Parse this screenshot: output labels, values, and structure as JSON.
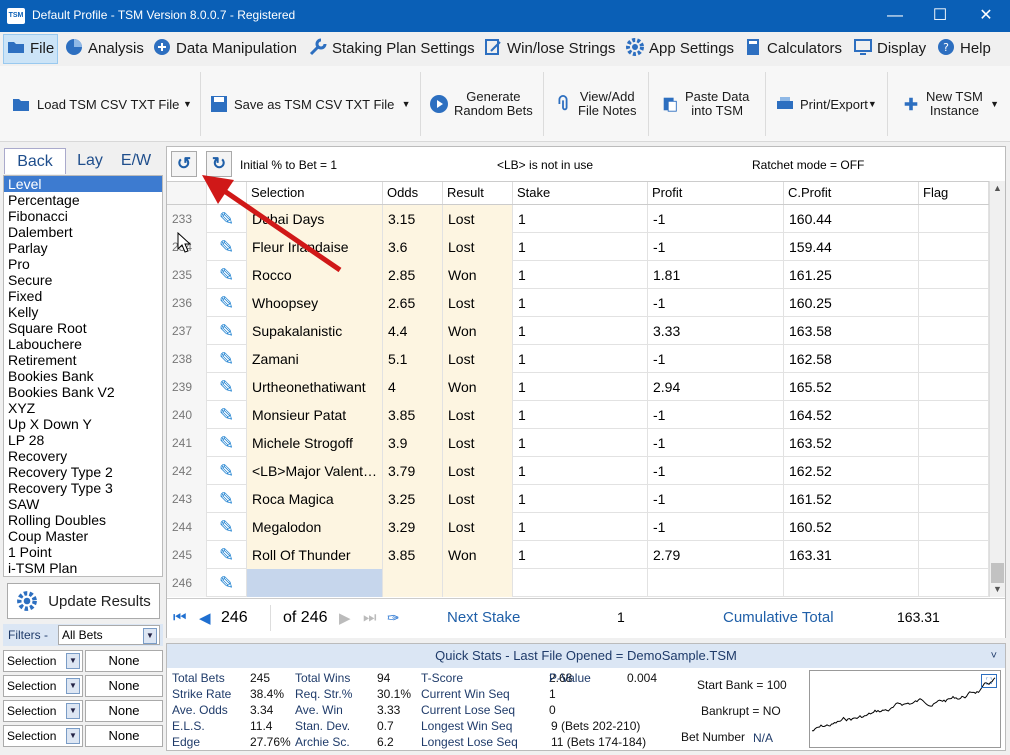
{
  "window": {
    "title": "Default Profile  -  TSM Version 8.0.0.7 - Registered",
    "logo": "TSM"
  },
  "menu": [
    "File",
    "Analysis",
    "Data Manipulation",
    "Staking Plan Settings",
    "Win/lose Strings",
    "App Settings",
    "Calculators",
    "Display",
    "Help"
  ],
  "ribbon": {
    "load": "Load TSM CSV TXT File",
    "save": "Save as TSM CSV TXT File",
    "gen1": "Generate",
    "gen2": "Random Bets",
    "notes1": "View/Add",
    "notes2": "File Notes",
    "paste1": "Paste Data",
    "paste2": "into TSM",
    "print": "Print/Export",
    "new1": "New TSM",
    "new2": "Instance"
  },
  "tabs": [
    "Back",
    "Lay",
    "E/W"
  ],
  "plans": [
    "Level",
    "Percentage",
    "Fibonacci",
    "Dalembert",
    "Parlay",
    "Pro",
    "Secure",
    "Fixed",
    "Kelly",
    "Square Root",
    "Labouchere",
    "Retirement",
    "Bookies Bank",
    "Bookies Bank V2",
    "XYZ",
    "Up X Down Y",
    "LP 28",
    "Recovery",
    "Recovery Type 2",
    "Recovery Type 3",
    "SAW",
    "Rolling Doubles",
    "Coup Master",
    "1 Point",
    "i-TSM Plan"
  ],
  "update_label": "Update Results",
  "filters": {
    "label": "Filters -",
    "value": "All Bets",
    "rows": [
      {
        "sel": "Selection",
        "val": "None"
      },
      {
        "sel": "Selection",
        "val": "None"
      },
      {
        "sel": "Selection",
        "val": "None"
      },
      {
        "sel": "Selection",
        "val": "None"
      }
    ]
  },
  "gridinfo": {
    "initial": "Initial % to Bet = 1",
    "lb": "<LB> is not in use",
    "ratchet": "Ratchet mode = OFF"
  },
  "headers": [
    "Selection",
    "Odds",
    "Result",
    "Stake",
    "Profit",
    "C.Profit",
    "Flag"
  ],
  "rows": [
    {
      "n": "233",
      "sel": "Dubai Days",
      "odds": "3.15",
      "res": "Lost",
      "stake": "1",
      "profit": "-1",
      "cp": "160.44"
    },
    {
      "n": "234",
      "sel": "Fleur Irlandaise",
      "odds": "3.6",
      "res": "Lost",
      "stake": "1",
      "profit": "-1",
      "cp": "159.44"
    },
    {
      "n": "235",
      "sel": "Rocco",
      "odds": "2.85",
      "res": "Won",
      "stake": "1",
      "profit": "1.81",
      "cp": "161.25"
    },
    {
      "n": "236",
      "sel": "Whoopsey",
      "odds": "2.65",
      "res": "Lost",
      "stake": "1",
      "profit": "-1",
      "cp": "160.25"
    },
    {
      "n": "237",
      "sel": "Supakalanistic",
      "odds": "4.4",
      "res": "Won",
      "stake": "1",
      "profit": "3.33",
      "cp": "163.58"
    },
    {
      "n": "238",
      "sel": "Zamani",
      "odds": "5.1",
      "res": "Lost",
      "stake": "1",
      "profit": "-1",
      "cp": "162.58"
    },
    {
      "n": "239",
      "sel": "Urtheonethatiwant",
      "odds": "4",
      "res": "Won",
      "stake": "1",
      "profit": "2.94",
      "cp": "165.52"
    },
    {
      "n": "240",
      "sel": "Monsieur Patat",
      "odds": "3.85",
      "res": "Lost",
      "stake": "1",
      "profit": "-1",
      "cp": "164.52"
    },
    {
      "n": "241",
      "sel": "Michele Strogoff",
      "odds": "3.9",
      "res": "Lost",
      "stake": "1",
      "profit": "-1",
      "cp": "163.52"
    },
    {
      "n": "242",
      "sel": "<LB>Major Valent…",
      "odds": "3.79",
      "res": "Lost",
      "stake": "1",
      "profit": "-1",
      "cp": "162.52"
    },
    {
      "n": "243",
      "sel": "Roca Magica",
      "odds": "3.25",
      "res": "Lost",
      "stake": "1",
      "profit": "-1",
      "cp": "161.52"
    },
    {
      "n": "244",
      "sel": "Megalodon",
      "odds": "3.29",
      "res": "Lost",
      "stake": "1",
      "profit": "-1",
      "cp": "160.52"
    },
    {
      "n": "245",
      "sel": "Roll Of Thunder",
      "odds": "3.85",
      "res": "Won",
      "stake": "1",
      "profit": "2.79",
      "cp": "163.31"
    },
    {
      "n": "246",
      "sel": "",
      "odds": "",
      "res": "",
      "stake": "",
      "profit": "",
      "cp": ""
    }
  ],
  "nav": {
    "current": "246",
    "of": "of 246",
    "next_label": "Next Stake",
    "next_value": "1",
    "cum_label": "Cumulative Total",
    "cum_value": "163.31"
  },
  "quickstats": {
    "header": "Quick Stats - Last File Opened = DemoSample.TSM",
    "col1": [
      [
        "Total Bets",
        "245"
      ],
      [
        "Strike Rate",
        "38.4%"
      ],
      [
        "Ave. Odds",
        "3.34"
      ],
      [
        "E.L.S.",
        "11.4"
      ],
      [
        "Edge",
        "27.76%"
      ]
    ],
    "col2": [
      [
        "Total Wins",
        "94"
      ],
      [
        "Req. Str.%",
        "30.1%"
      ],
      [
        "Ave. Win",
        "3.33"
      ],
      [
        "Stan. Dev.",
        "0.7"
      ],
      [
        "Archie Sc.",
        "6.2"
      ]
    ],
    "col3": [
      [
        "T-Score",
        "2.68"
      ],
      [
        "Current Win Seq",
        "1"
      ],
      [
        "Current Lose Seq",
        "0"
      ],
      [
        "Longest Win Seq",
        "9  (Bets 202-210)"
      ],
      [
        "Longest Lose Seq",
        "11  (Bets 174-184)"
      ]
    ],
    "pvalue_label": "P-Value",
    "pvalue": "0.004",
    "start_bank": "Start Bank = 100",
    "bankrupt": "Bankrupt = NO",
    "betnum_label": "Bet Number",
    "betnum": "N/A"
  },
  "accent": "#0a5fb6"
}
